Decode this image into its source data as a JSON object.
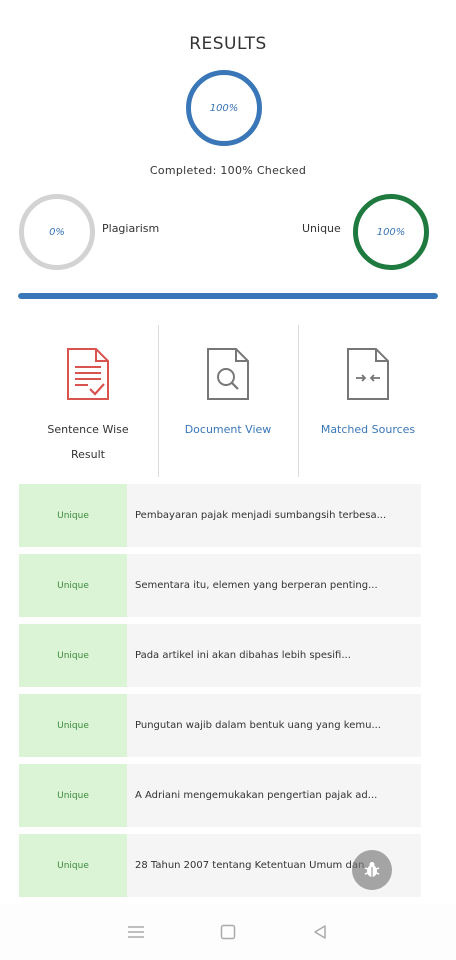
{
  "header": {
    "title": "RESULTS"
  },
  "overall": {
    "percent_label": "100%",
    "completed_text": "Completed: 100% Checked"
  },
  "plagiarism": {
    "percent_label": "0%",
    "label": "Plagiarism"
  },
  "unique": {
    "percent_label": "100%",
    "label": "Unique"
  },
  "progress": {
    "value_percent": 100,
    "color": "#3a77b8"
  },
  "views": [
    {
      "label": "Sentence Wise Result",
      "icon": "document-check-icon",
      "color": "#d9534f"
    },
    {
      "label": "Document View",
      "icon": "document-search-icon",
      "color": "#3a77b8"
    },
    {
      "label": "Matched Sources",
      "icon": "document-compare-icon",
      "color": "#3a77b8"
    }
  ],
  "sentences": [
    {
      "status": "Unique",
      "text": "Pembayaran pajak menjadi sumbangsih terbesa..."
    },
    {
      "status": "Unique",
      "text": "Sementara itu, elemen yang berperan penting..."
    },
    {
      "status": "Unique",
      "text": "Pada artikel ini akan dibahas lebih spesifi..."
    },
    {
      "status": "Unique",
      "text": "Pungutan wajib dalam bentuk uang yang kemu..."
    },
    {
      "status": "Unique",
      "text": "A Adriani mengemukakan pengertian pajak ad..."
    },
    {
      "status": "Unique",
      "text": "28 Tahun 2007 tentang Ketentuan Umum dan..."
    }
  ],
  "colors": {
    "accent_blue": "#3a77b8",
    "unique_green": "#1e7a3f",
    "plagiarism_gray": "#d3d3d3",
    "unique_bg": "#dbf4d5"
  },
  "fab": {
    "icon": "bug-icon"
  },
  "navbar": {
    "icons": [
      "menu-icon",
      "home-square-icon",
      "back-triangle-icon"
    ]
  }
}
